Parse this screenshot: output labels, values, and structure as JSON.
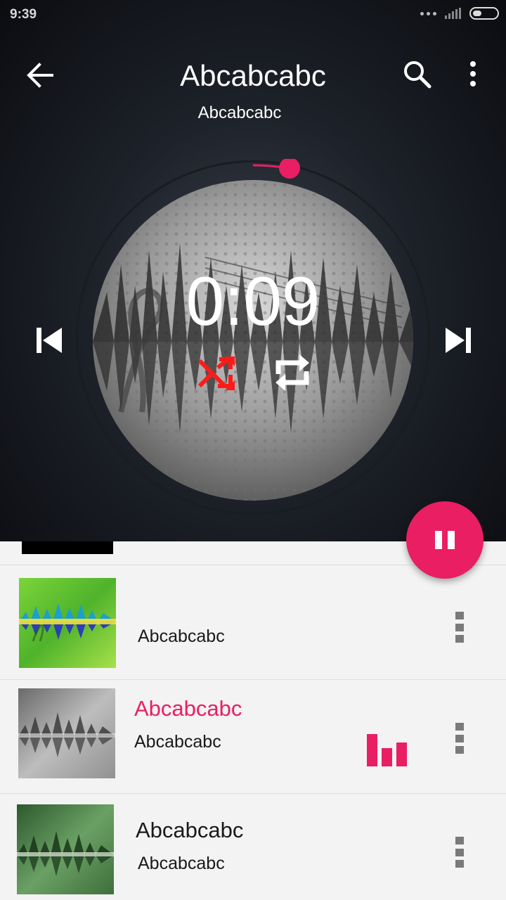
{
  "status": {
    "time": "9:39"
  },
  "header": {
    "title": "Abcabcabc",
    "subtitle": "Abcabcabc"
  },
  "player": {
    "elapsed": "0:09",
    "shuffle_on": true,
    "repeat_on": false,
    "progress_fraction": 0.04
  },
  "colors": {
    "accent": "#e91e63",
    "shuffle": "#ff1a1a"
  },
  "list": {
    "items": [
      {
        "title": "",
        "subtitle": "Abcabcabc",
        "playing": false,
        "art": "green-waveform"
      },
      {
        "title": "Abcabcabc",
        "subtitle": "Abcabcabc",
        "playing": true,
        "art": "gray-waveform"
      },
      {
        "title": "Abcabcabc",
        "subtitle": "Abcabcabc",
        "playing": false,
        "art": "dark-green-waveform"
      }
    ]
  }
}
